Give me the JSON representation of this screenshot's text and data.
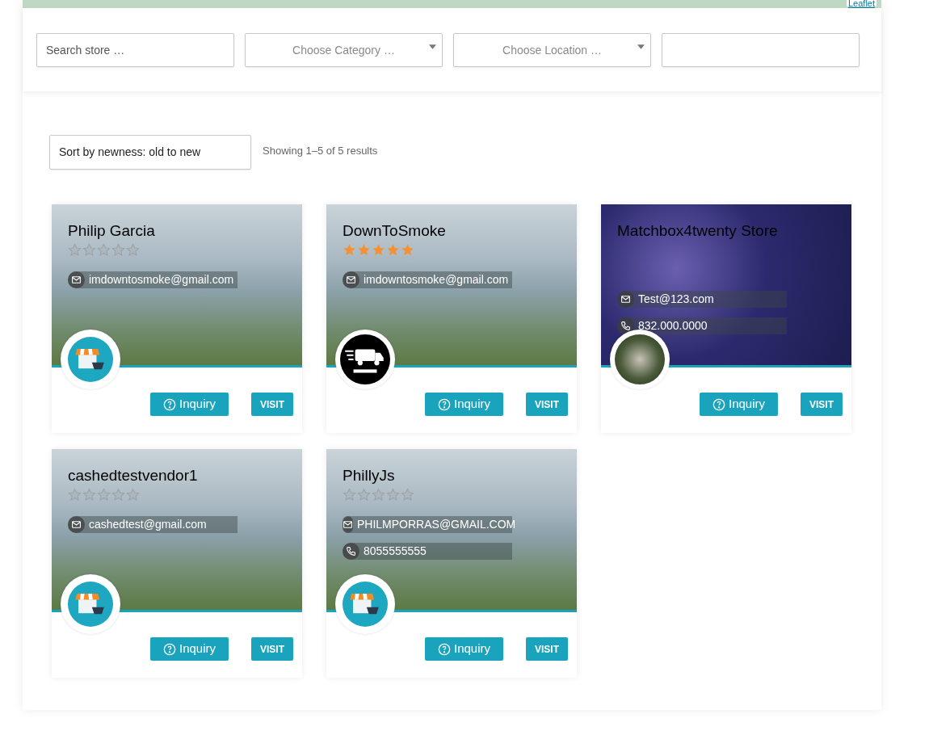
{
  "map": {
    "attribution": "Leaflet"
  },
  "filters": {
    "search": {
      "placeholder": "Search store …"
    },
    "category": {
      "placeholder": "Choose Category …"
    },
    "location": {
      "placeholder": "Choose Location …"
    }
  },
  "sort": {
    "value": "Sort by newness: old to new"
  },
  "result_count": "Showing 1–5 of 5 results",
  "stores": [
    {
      "name": "Philip Garcia",
      "banner": {
        "kind": "mountains"
      },
      "avatar": {
        "kind": "store"
      },
      "stars": 0,
      "contacts": [
        {
          "kind": "email",
          "text": "imdowntosmoke@gmail.com"
        }
      ],
      "inquiry": "Inquiry",
      "visit": "VISIT"
    },
    {
      "name": "DownToSmoke",
      "banner": {
        "kind": "mountains"
      },
      "avatar": {
        "kind": "truck"
      },
      "stars": 5,
      "contacts": [
        {
          "kind": "email",
          "text": "imdowntosmoke@gmail.com"
        }
      ],
      "inquiry": "Inquiry",
      "visit": "VISIT"
    },
    {
      "name": "Matchbox4twenty Store",
      "banner": {
        "kind": "lights"
      },
      "avatar": {
        "kind": "photo"
      },
      "contacts": [
        {
          "kind": "email",
          "text": "Test@123.com"
        },
        {
          "kind": "phone",
          "text": "832.000.0000"
        }
      ],
      "inquiry": "Inquiry",
      "visit": "VISIT"
    },
    {
      "name": "cashedtestvendor1",
      "banner": {
        "kind": "mountains"
      },
      "avatar": {
        "kind": "store"
      },
      "stars": 0,
      "contacts": [
        {
          "kind": "email",
          "text": "cashedtest@gmail.com"
        }
      ],
      "inquiry": "Inquiry",
      "visit": "VISIT"
    },
    {
      "name": "PhillyJs",
      "banner": {
        "kind": "mountains"
      },
      "avatar": {
        "kind": "store"
      },
      "stars": 0,
      "contacts": [
        {
          "kind": "email",
          "text": "PHILMPORRAS@GMAIL.COM"
        },
        {
          "kind": "phone",
          "text": "8055555555"
        }
      ],
      "inquiry": "Inquiry",
      "visit": "VISIT"
    }
  ]
}
